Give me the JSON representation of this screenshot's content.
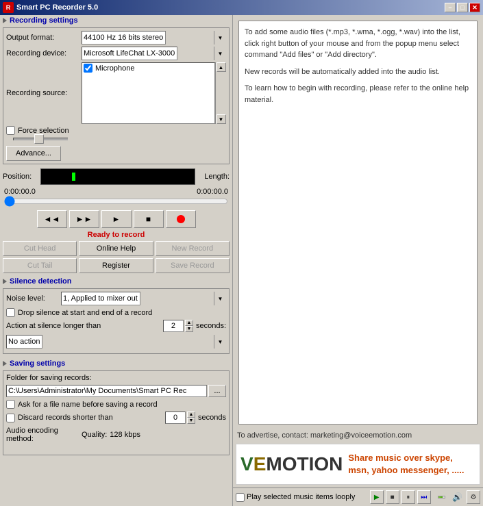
{
  "window": {
    "title": "Smart PC Recorder 5.0",
    "min_label": "–",
    "max_label": "□",
    "close_label": "✕"
  },
  "recording_settings": {
    "header": "Recording settings",
    "output_format_label": "Output format:",
    "output_format_value": "44100 Hz 16 bits stereo",
    "recording_device_label": "Recording device:",
    "recording_device_value": "Microsoft LifeChat LX-3000",
    "recording_source_label": "Recording source:",
    "microphone_label": "Microphone",
    "force_selection_label": "Force selection",
    "advance_button": "Advance..."
  },
  "transport": {
    "position_label": "Position:",
    "position_time": "0:00:00.0",
    "length_label": "Length:",
    "length_time": "0:00:00.0",
    "status": "Ready to record"
  },
  "transport_buttons": {
    "rewind": "◄◄",
    "forward": "►►",
    "play": "►",
    "stop": "■"
  },
  "action_buttons": {
    "cut_head": "Cut Head",
    "online_help": "Online Help",
    "new_record": "New Record",
    "cut_tail": "Cut Tail",
    "register": "Register",
    "save_record": "Save Record"
  },
  "silence_detection": {
    "header": "Silence detection",
    "noise_level_label": "Noise level:",
    "noise_level_value": "1, Applied to mixer out",
    "drop_silence_label": "Drop silence at start and end of a record",
    "action_label": "Action at silence longer than",
    "seconds_value": "2",
    "seconds_unit": "seconds:",
    "no_action_value": "No action"
  },
  "saving_settings": {
    "header": "Saving settings",
    "folder_label": "Folder for saving records:",
    "folder_path": "C:\\Users\\Administrator\\My Documents\\Smart PC Rec",
    "browse_label": "...",
    "ask_filename_label": "Ask for a file name before saving a record",
    "discard_short_label": "Discard records shorter than",
    "discard_value": "0",
    "discard_unit": "seconds",
    "encoding_label": "Audio encoding method:",
    "quality_label": "Quality:",
    "quality_value": "128 kbps"
  },
  "info_text": {
    "para1": "To add some audio files (*.mp3, *.wma, *.ogg, *.wav) into the list, click right button of your mouse and from the popup menu select command \"Add files\" or \"Add directory\".",
    "para2": "New records will be automatically added into the audio list.",
    "para3": "To learn how to begin with recording, please refer to the online help material."
  },
  "ad": {
    "contact": "To advertise, contact: marketing@voiceemotion.com",
    "logo_v": "V",
    "logo_rest": "EMOTION",
    "text": "Share music over skype, msn, yahoo messenger, ....."
  },
  "bottom": {
    "loop_label": "Play selected music items looply",
    "play": "▶",
    "stop": "■",
    "pause": "⏸",
    "skip": "⏭"
  }
}
